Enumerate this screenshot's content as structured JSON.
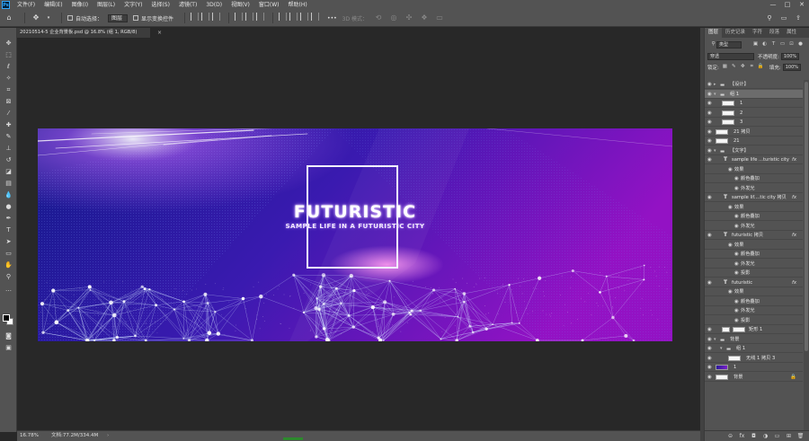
{
  "app": {
    "logo": "Ps"
  },
  "menu": [
    "文件(F)",
    "编辑(E)",
    "图像(I)",
    "图层(L)",
    "文字(Y)",
    "选择(S)",
    "滤镜(T)",
    "3D(D)",
    "视图(V)",
    "窗口(W)",
    "帮助(H)"
  ],
  "window_controls": [
    "—",
    "□",
    "✕"
  ],
  "options": {
    "home_icon": "home-icon",
    "move_icon": "move-icon",
    "auto_select_label": "自动选择：",
    "auto_select_value": "图层",
    "show_transform_label": "显示变换控件",
    "more": "•••",
    "mode_3d_label": "3D 模式："
  },
  "document": {
    "tab_title": "20210514-5 企业背景板.psd @ 16.8% (组 1, RGB/8)",
    "tab_close": "×"
  },
  "artwork": {
    "title": "FUTURISTIC",
    "subtitle": "SAMPLE LIFE IN A FUTURISTIC CITY",
    "colors": {
      "bg_left": "#141a8c",
      "bg_right": "#9312c4",
      "glow": "#ffffff",
      "accent": "#c86bff"
    }
  },
  "status": {
    "zoom": "16.78%",
    "doc_info": "文档:77.2M/334.4M",
    "arrow": "›",
    "progress": 1.0
  },
  "panel": {
    "tabs": [
      "图层",
      "历史记录",
      "字符",
      "段落",
      "属性"
    ],
    "kind_label": "类型",
    "blend_mode": "穿透",
    "opacity_label": "不透明度:",
    "opacity_value": "100%",
    "lock_label": "锁定:",
    "fill_label": "填充:",
    "fill_value": "100%"
  },
  "layers": [
    {
      "type": "group",
      "name": "【设计】",
      "indent": 0,
      "expanded": false
    },
    {
      "type": "group",
      "name": "组 1",
      "indent": 0,
      "expanded": true,
      "selected": true
    },
    {
      "type": "pixel",
      "name": "1",
      "indent": 1
    },
    {
      "type": "pixel",
      "name": "2",
      "indent": 1
    },
    {
      "type": "pixel",
      "name": "3",
      "indent": 1
    },
    {
      "type": "pixel",
      "name": "21 拷贝",
      "indent": 0
    },
    {
      "type": "pixel",
      "name": "21",
      "indent": 0
    },
    {
      "type": "group",
      "name": "【文字】",
      "indent": 0,
      "expanded": true
    },
    {
      "type": "text",
      "name": "sample life ...turistic city",
      "indent": 1,
      "fx": true
    },
    {
      "type": "effect",
      "name": "效果",
      "indent": 2
    },
    {
      "type": "effect",
      "name": "颜色叠加",
      "indent": 3
    },
    {
      "type": "effect",
      "name": "外发光",
      "indent": 3
    },
    {
      "type": "text",
      "name": "sample lif....tic city 拷贝",
      "indent": 1,
      "fx": true
    },
    {
      "type": "effect",
      "name": "效果",
      "indent": 2
    },
    {
      "type": "effect",
      "name": "颜色叠加",
      "indent": 3
    },
    {
      "type": "effect",
      "name": "外发光",
      "indent": 3
    },
    {
      "type": "text",
      "name": "futuristic 拷贝",
      "indent": 1,
      "fx": true
    },
    {
      "type": "effect",
      "name": "效果",
      "indent": 2
    },
    {
      "type": "effect",
      "name": "颜色叠加",
      "indent": 3
    },
    {
      "type": "effect",
      "name": "外发光",
      "indent": 3
    },
    {
      "type": "effect",
      "name": "投影",
      "indent": 3
    },
    {
      "type": "text",
      "name": "futuristic",
      "indent": 1,
      "fx": true
    },
    {
      "type": "effect",
      "name": "效果",
      "indent": 2
    },
    {
      "type": "effect",
      "name": "颜色叠加",
      "indent": 3
    },
    {
      "type": "effect",
      "name": "外发光",
      "indent": 3
    },
    {
      "type": "effect",
      "name": "投影",
      "indent": 3
    },
    {
      "type": "shape",
      "name": "矩形 1",
      "indent": 1
    },
    {
      "type": "group",
      "name": "背景",
      "indent": 0,
      "expanded": true
    },
    {
      "type": "group",
      "name": "组 1",
      "indent": 1,
      "expanded": true
    },
    {
      "type": "pixel",
      "name": "无线 1 拷贝 3",
      "indent": 2
    },
    {
      "type": "pixel-blue",
      "name": "1",
      "indent": 0
    },
    {
      "type": "pixel",
      "name": "背景",
      "indent": 0,
      "locked": true
    }
  ],
  "footer_icons": [
    "link-icon",
    "fx-icon",
    "mask-icon",
    "adjustment-icon",
    "new-group-icon",
    "new-layer-icon",
    "delete-icon"
  ],
  "footer_glyphs": [
    "⊝",
    "fx",
    "◘",
    "◑",
    "▭",
    "⊞",
    "🗑"
  ]
}
